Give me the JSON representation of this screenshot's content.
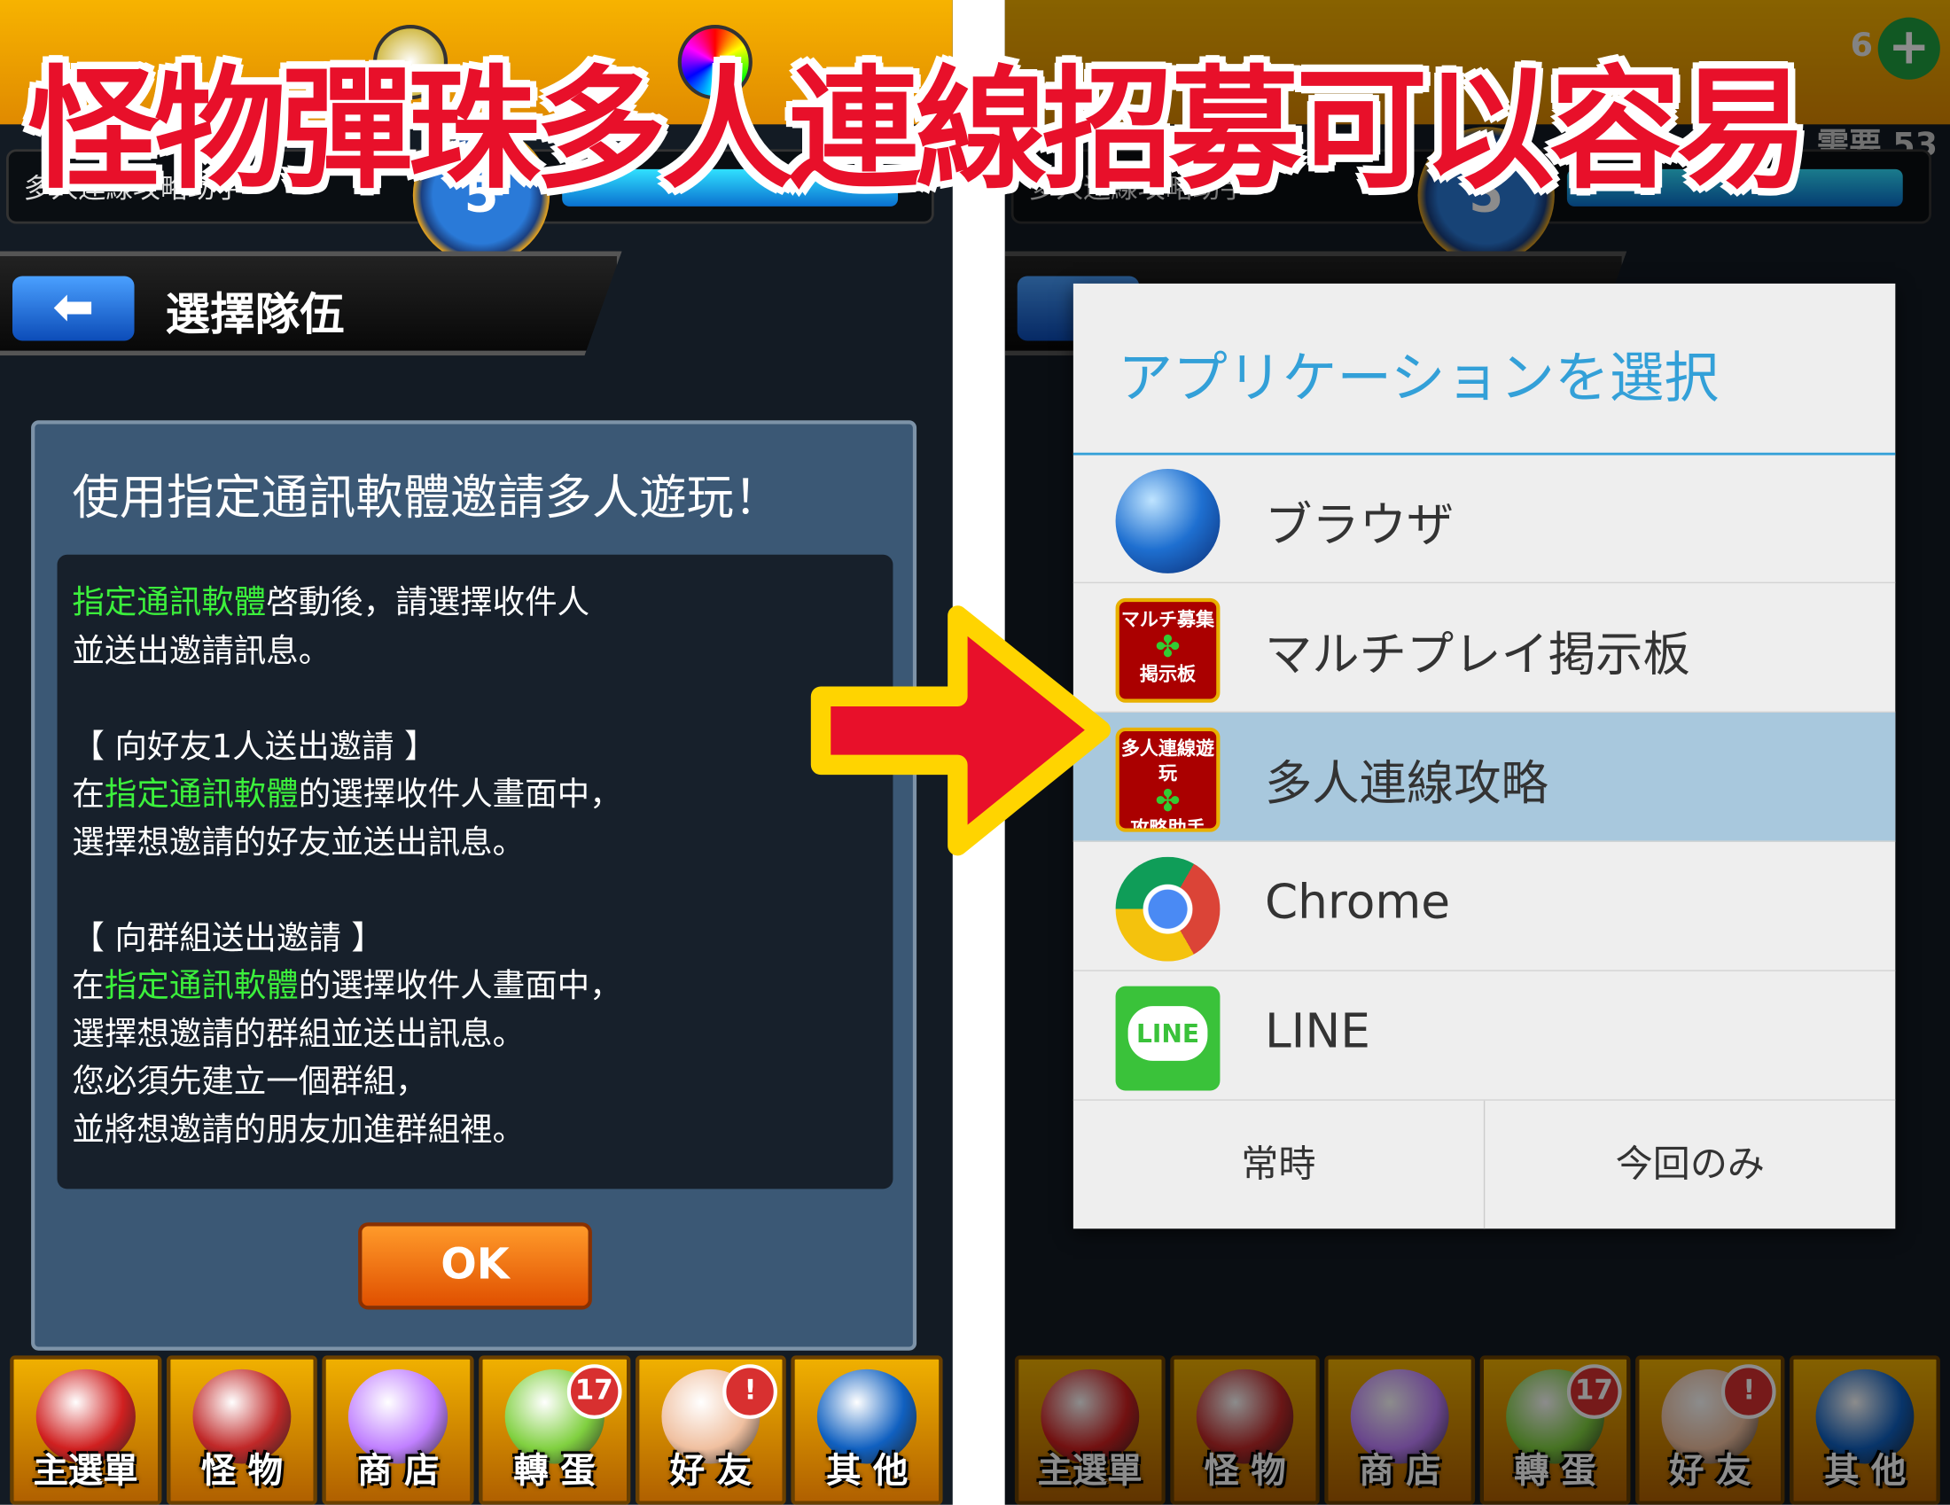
{
  "headline": "怪物彈珠多人連線招募可以容易",
  "left": {
    "player_name": "多人連線攻略助手",
    "level": "5",
    "header_title": "選擇隊伍",
    "back_icon": "arrow-left-icon",
    "dialog": {
      "title": "使用指定通訊軟體邀請多人遊玩！",
      "lines": [
        [
          {
            "t": "指定通訊軟體",
            "g": true
          },
          {
            "t": "啓動後，請選擇收件人"
          }
        ],
        [
          {
            "t": "並送出邀請訊息。"
          }
        ],
        [
          {
            "t": ""
          }
        ],
        [
          {
            "t": "【 向好友1人送出邀請 】"
          }
        ],
        [
          {
            "t": "在"
          },
          {
            "t": "指定通訊軟體",
            "g": true
          },
          {
            "t": "的選擇收件人畫面中，"
          }
        ],
        [
          {
            "t": "選擇想邀請的好友並送出訊息。"
          }
        ],
        [
          {
            "t": ""
          }
        ],
        [
          {
            "t": "【 向群組送出邀請 】"
          }
        ],
        [
          {
            "t": "在"
          },
          {
            "t": "指定通訊軟體",
            "g": true
          },
          {
            "t": "的選擇收件人畫面中，"
          }
        ],
        [
          {
            "t": "選擇想邀請的群組並送出訊息。"
          }
        ],
        [
          {
            "t": "您必須先建立一個群組，"
          }
        ],
        [
          {
            "t": "並將想邀請的朋友加進群組裡。"
          }
        ]
      ],
      "ok_label": "OK"
    }
  },
  "nav": [
    {
      "label": "主選單",
      "color": "#d02020"
    },
    {
      "label": "怪 物",
      "color": "#c02828"
    },
    {
      "label": "商 店",
      "color": "#c080ff"
    },
    {
      "label": "轉 蛋",
      "color": "#80d040",
      "badge": "17"
    },
    {
      "label": "好 友",
      "color": "#f0c0a0",
      "badge": "!"
    },
    {
      "label": "其 他",
      "color": "#1060c0"
    }
  ],
  "right": {
    "stamina": "6",
    "need": "需要 53",
    "player_name": "多人連線攻略助手",
    "level": "5",
    "chooser": {
      "title": "アプリケーションを選択",
      "apps": [
        {
          "label": "ブラウザ",
          "icon": "globe-icon"
        },
        {
          "label": "マルチプレイ掲示板",
          "icon": "multiplay-board-app-icon",
          "logo": [
            "マルチ募集",
            "掲示板"
          ]
        },
        {
          "label": "多人連線攻略",
          "icon": "multiplayer-helper-app-icon",
          "logo": [
            "多人連線遊玩",
            "攻略助手"
          ],
          "selected": true
        },
        {
          "label": "Chrome",
          "icon": "chrome-icon"
        },
        {
          "label": "LINE",
          "icon": "line-icon",
          "logo": [
            "LINE"
          ]
        }
      ],
      "always_label": "常時",
      "once_label": "今回のみ"
    }
  },
  "colors": {
    "accent": "#33a0d8",
    "selected_row": "#a8c8dd",
    "headline": "#e8102a",
    "arrow": "#e8102a",
    "arrow_border": "#ffd400",
    "highlight_text": "#3cf03c"
  }
}
